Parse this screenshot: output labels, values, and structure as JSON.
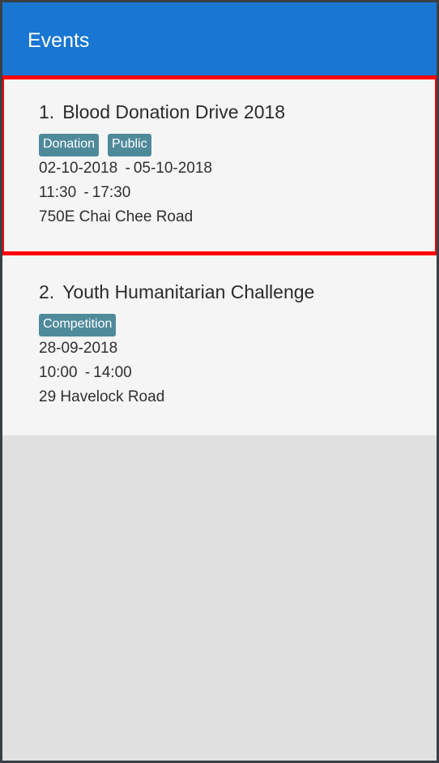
{
  "header": {
    "title": "Events"
  },
  "events": [
    {
      "index": "1.",
      "name": "Blood Donation Drive 2018",
      "tags": [
        "Donation",
        "Public"
      ],
      "start_date": "02-10-2018",
      "end_date": "05-10-2018",
      "start_time": "11:30",
      "end_time": "17:30",
      "location": "750E Chai Chee Road"
    },
    {
      "index": "2.",
      "name": "Youth Humanitarian Challenge",
      "tags": [
        "Competition"
      ],
      "start_date": "28-09-2018",
      "end_date": "",
      "start_time": "10:00",
      "end_time": "14:00",
      "location": "29 Havelock Road"
    }
  ],
  "colors": {
    "header_bg": "#1976d2",
    "tag_bg": "#4f8a9b",
    "selection_border": "#ff0000",
    "card_bg": "#f5f5f6",
    "empty_bg": "#e0e0e0"
  }
}
